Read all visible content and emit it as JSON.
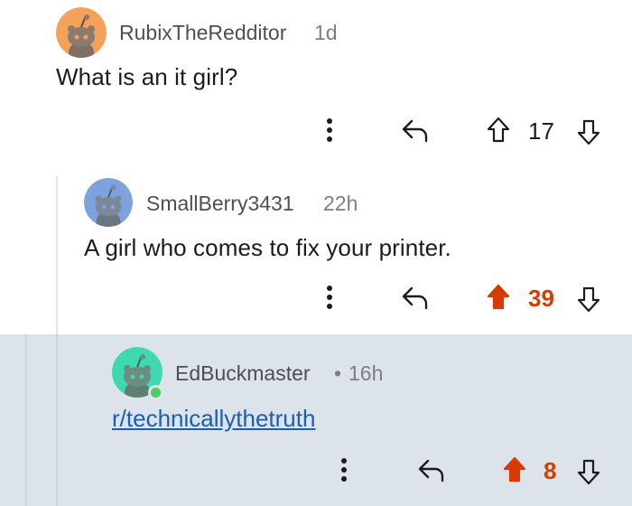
{
  "colors": {
    "upvote_active": "#d93a00",
    "link": "#1a5fb4",
    "highlight_background": "#dde3ea",
    "avatar_orange": "#f4a259",
    "avatar_blue": "#7da2e0",
    "avatar_teal": "#3ed9b1"
  },
  "comments": [
    {
      "username": "RubixTheRedditor",
      "age": "1d",
      "body": "What is an it girl?",
      "score": "17",
      "vote_state": "none",
      "avatar_color": "#f4a259",
      "icons": [
        "more-vertical-icon",
        "reply-icon",
        "upvote-icon",
        "downvote-icon"
      ]
    },
    {
      "username": "SmallBerry3431",
      "age": "22h",
      "body": "A girl who comes to fix your printer.",
      "score": "39",
      "vote_state": "upvoted",
      "avatar_color": "#7da2e0",
      "icons": [
        "more-vertical-icon",
        "reply-icon",
        "upvote-filled-icon",
        "downvote-icon"
      ]
    },
    {
      "username": "EdBuckmaster",
      "separator": "•",
      "age": "16h",
      "body_link": "r/technicallythetruth",
      "score": "8",
      "vote_state": "upvoted",
      "online": true,
      "avatar_color": "#3ed9b1",
      "icons": [
        "more-vertical-icon",
        "reply-icon",
        "upvote-filled-icon",
        "downvote-icon"
      ]
    }
  ]
}
